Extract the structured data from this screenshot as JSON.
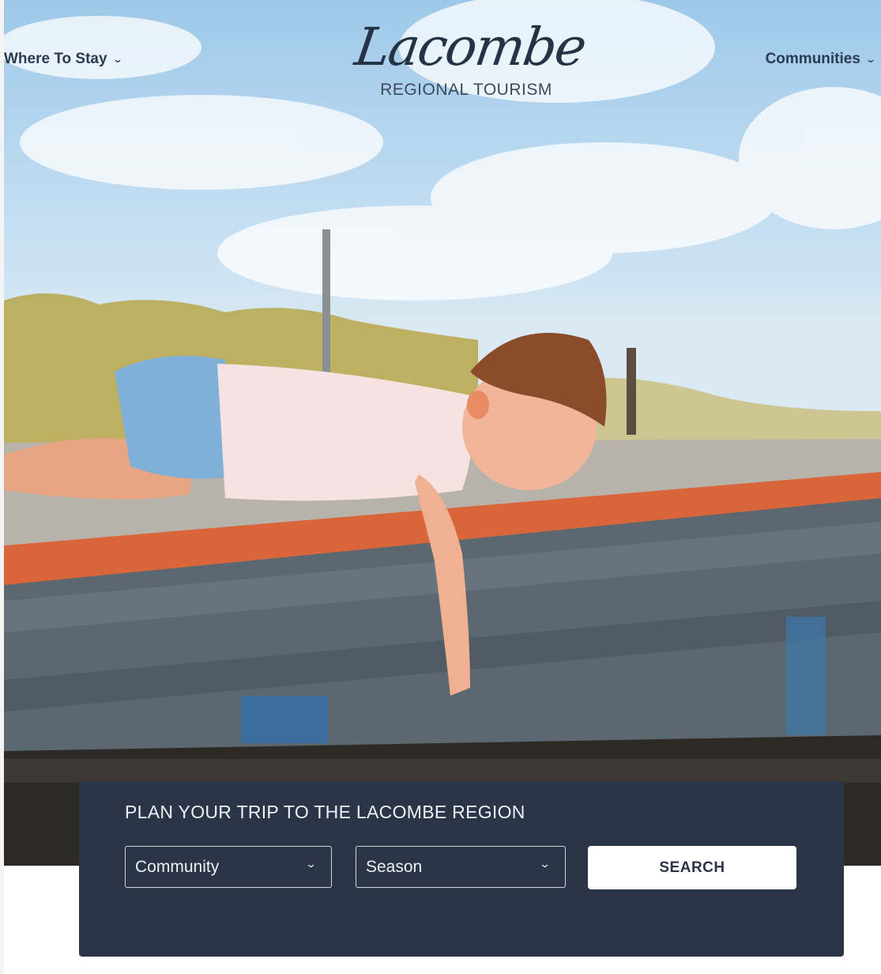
{
  "header": {
    "nav_left": {
      "label": "Where To Stay",
      "icon": "chevron-down-icon"
    },
    "nav_right": {
      "label": "Communities",
      "icon": "chevron-down-icon"
    },
    "logo": {
      "script": "Lacombe",
      "subtitle": "REGIONAL TOURISM"
    }
  },
  "hero": {
    "image": "photo of a boy lying on a wooden dock reaching into the water"
  },
  "planner": {
    "title": "PLAN YOUR TRIP TO THE LACOMBE REGION",
    "community_select": {
      "value": "Community",
      "icon": "chevron-down-icon"
    },
    "season_select": {
      "value": "Season",
      "icon": "chevron-down-icon"
    },
    "search_label": "SEARCH"
  },
  "colors": {
    "navy": "#2b3548",
    "sky": "#b8d8f0",
    "dock_trim": "#d9653a",
    "white": "#ffffff"
  }
}
